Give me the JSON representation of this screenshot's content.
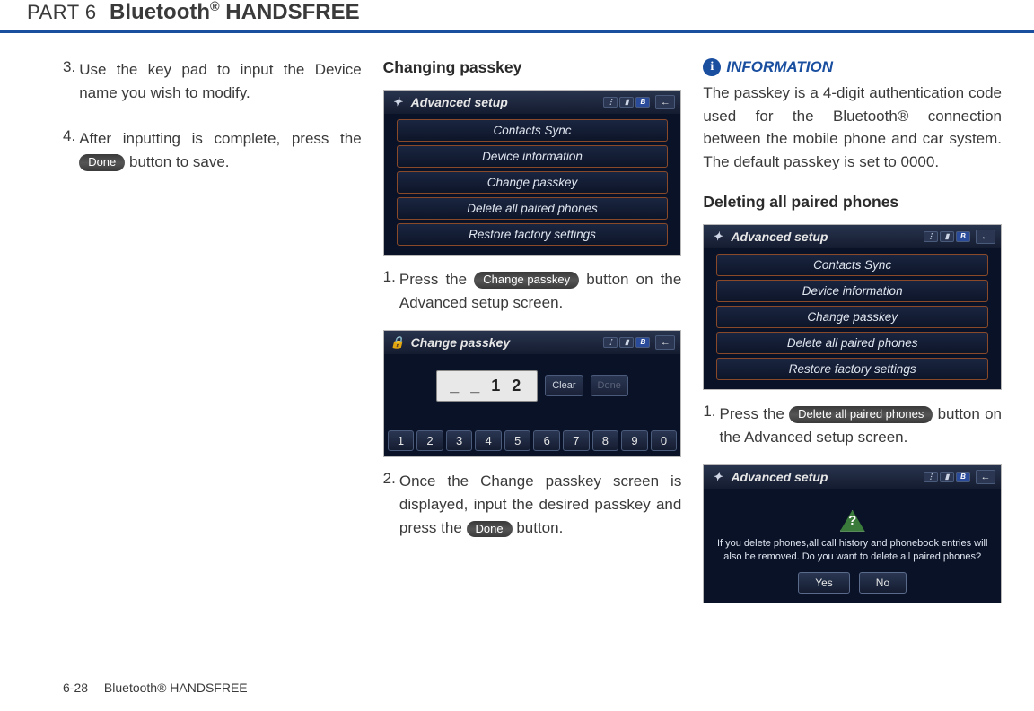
{
  "header": {
    "part_label": "PART 6",
    "title_html": "Bluetooth® HANDSFREE"
  },
  "col1": {
    "step3_num": "3.",
    "step3_text": "Use the key pad to input the Device name you wish to modify.",
    "step4_num": "4.",
    "step4_pre": "After inputting is complete, press the ",
    "step4_btn": "Done",
    "step4_post": " button to save."
  },
  "col2": {
    "heading": "Changing passkey",
    "adv_title": "Advanced setup",
    "adv_items": [
      "Contacts Sync",
      "Device information",
      "Change passkey",
      "Delete all paired phones",
      "Restore factory settings"
    ],
    "s1_num": "1.",
    "s1_pre": "Press the ",
    "s1_btn": "Change passkey",
    "s1_post": " button on the Advanced setup screen.",
    "pk_title": "Change passkey",
    "pk_display": "_ _ 1 2",
    "pk_clear": "Clear",
    "pk_done": "Done",
    "pk_keys": [
      "1",
      "2",
      "3",
      "4",
      "5",
      "6",
      "7",
      "8",
      "9",
      "0"
    ],
    "s2_num": "2.",
    "s2_pre": "Once the Change passkey screen is displayed, input the desired passkey and press the ",
    "s2_btn": "Done",
    "s2_post": " button."
  },
  "col3": {
    "info_label": "INFORMATION",
    "info_body": "The passkey is a 4-digit authentication code used for the Bluetooth® connection between the mobile phone and car system. The default passkey is set to 0000.",
    "heading": "Deleting all paired phones",
    "adv_title": "Advanced setup",
    "adv_items": [
      "Contacts Sync",
      "Device information",
      "Change passkey",
      "Delete all paired phones",
      "Restore factory settings"
    ],
    "s1_num": "1.",
    "s1_pre": "Press the ",
    "s1_btn": "Delete all paired phones",
    "s1_post": " button on the Advanced setup screen.",
    "dlg_title": "Advanced setup",
    "dlg_text": "If you delete phones,all call history and phonebook entries will also be removed. Do you want to delete all paired phones?",
    "dlg_yes": "Yes",
    "dlg_no": "No"
  },
  "footer": {
    "pagenum": "6-28",
    "label": "Bluetooth® HANDSFREE"
  }
}
